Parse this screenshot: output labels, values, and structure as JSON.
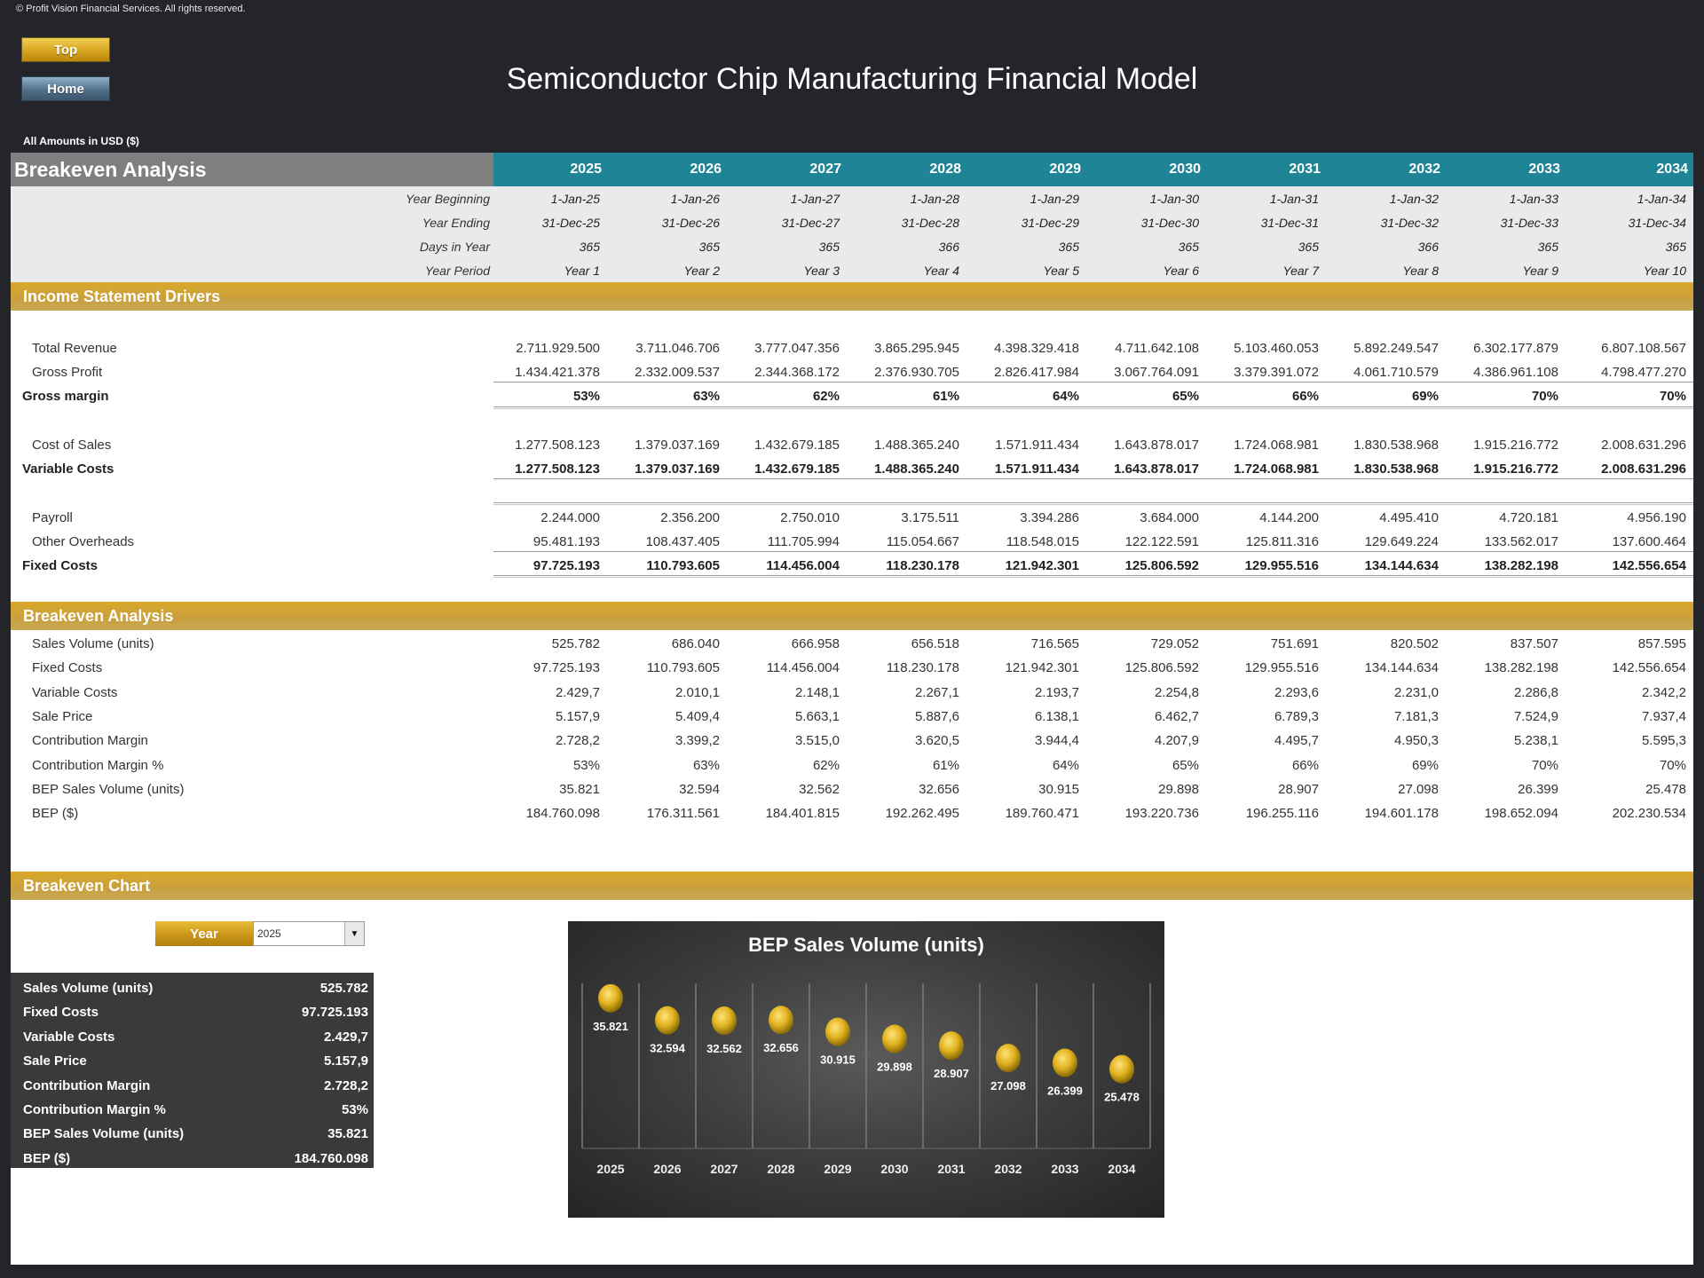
{
  "copyright": "© Profit Vision Financial Services. All rights reserved.",
  "nav": {
    "top_label": "Top",
    "home_label": "Home"
  },
  "page_title": "Semiconductor Chip Manufacturing Financial Model",
  "currency_note": "All Amounts in  USD ($)",
  "colors": {
    "teal": "#1f8596",
    "gold": "#d9a92a",
    "gray_header": "#7f7f7f",
    "dark_bg": "#23252b"
  },
  "header": {
    "title": "Breakeven Analysis",
    "years": [
      "2025",
      "2026",
      "2027",
      "2028",
      "2029",
      "2030",
      "2031",
      "2032",
      "2033",
      "2034"
    ]
  },
  "meta": [
    {
      "label": "Year Beginning",
      "values": [
        "1-Jan-25",
        "1-Jan-26",
        "1-Jan-27",
        "1-Jan-28",
        "1-Jan-29",
        "1-Jan-30",
        "1-Jan-31",
        "1-Jan-32",
        "1-Jan-33",
        "1-Jan-34"
      ]
    },
    {
      "label": "Year Ending",
      "values": [
        "31-Dec-25",
        "31-Dec-26",
        "31-Dec-27",
        "31-Dec-28",
        "31-Dec-29",
        "31-Dec-30",
        "31-Dec-31",
        "31-Dec-32",
        "31-Dec-33",
        "31-Dec-34"
      ]
    },
    {
      "label": "Days in Year",
      "values": [
        "365",
        "365",
        "365",
        "366",
        "365",
        "365",
        "365",
        "366",
        "365",
        "365"
      ]
    },
    {
      "label": "Year Period",
      "values": [
        "Year 1",
        "Year 2",
        "Year 3",
        "Year 4",
        "Year 5",
        "Year 6",
        "Year 7",
        "Year 8",
        "Year 9",
        "Year 10"
      ]
    }
  ],
  "income_section": {
    "title": "Income Statement Drivers",
    "rows": [
      {
        "label": "Total Revenue",
        "bold": false,
        "values": [
          "2.711.929.500",
          "3.711.046.706",
          "3.777.047.356",
          "3.865.295.945",
          "4.398.329.418",
          "4.711.642.108",
          "5.103.460.053",
          "5.892.249.547",
          "6.302.177.879",
          "6.807.108.567"
        ]
      },
      {
        "label": "Gross Profit",
        "bold": false,
        "values": [
          "1.434.421.378",
          "2.332.009.537",
          "2.344.368.172",
          "2.376.930.705",
          "2.826.417.984",
          "3.067.764.091",
          "3.379.391.072",
          "4.061.710.579",
          "4.386.961.108",
          "4.798.477.270"
        ]
      },
      {
        "label": "Gross margin",
        "bold": true,
        "values": [
          "53%",
          "63%",
          "62%",
          "61%",
          "64%",
          "65%",
          "66%",
          "69%",
          "70%",
          "70%"
        ]
      },
      {
        "label": "Cost of Sales",
        "bold": false,
        "values": [
          "1.277.508.123",
          "1.379.037.169",
          "1.432.679.185",
          "1.488.365.240",
          "1.571.911.434",
          "1.643.878.017",
          "1.724.068.981",
          "1.830.538.968",
          "1.915.216.772",
          "2.008.631.296"
        ]
      },
      {
        "label": "Variable Costs",
        "bold": true,
        "values": [
          "1.277.508.123",
          "1.379.037.169",
          "1.432.679.185",
          "1.488.365.240",
          "1.571.911.434",
          "1.643.878.017",
          "1.724.068.981",
          "1.830.538.968",
          "1.915.216.772",
          "2.008.631.296"
        ]
      },
      {
        "label": "Payroll",
        "bold": false,
        "values": [
          "2.244.000",
          "2.356.200",
          "2.750.010",
          "3.175.511",
          "3.394.286",
          "3.684.000",
          "4.144.200",
          "4.495.410",
          "4.720.181",
          "4.956.190"
        ]
      },
      {
        "label": "Other Overheads",
        "bold": false,
        "values": [
          "95.481.193",
          "108.437.405",
          "111.705.994",
          "115.054.667",
          "118.548.015",
          "122.122.591",
          "125.811.316",
          "129.649.224",
          "133.562.017",
          "137.600.464"
        ]
      },
      {
        "label": "Fixed Costs",
        "bold": true,
        "values": [
          "97.725.193",
          "110.793.605",
          "114.456.004",
          "118.230.178",
          "121.942.301",
          "125.806.592",
          "129.955.516",
          "134.144.634",
          "138.282.198",
          "142.556.654"
        ]
      }
    ]
  },
  "breakeven_section": {
    "title": "Breakeven Analysis",
    "rows": [
      {
        "label": "Sales Volume (units)",
        "values": [
          "525.782",
          "686.040",
          "666.958",
          "656.518",
          "716.565",
          "729.052",
          "751.691",
          "820.502",
          "837.507",
          "857.595"
        ]
      },
      {
        "label": "Fixed Costs",
        "values": [
          "97.725.193",
          "110.793.605",
          "114.456.004",
          "118.230.178",
          "121.942.301",
          "125.806.592",
          "129.955.516",
          "134.144.634",
          "138.282.198",
          "142.556.654"
        ]
      },
      {
        "label": "Variable Costs",
        "values": [
          "2.429,7",
          "2.010,1",
          "2.148,1",
          "2.267,1",
          "2.193,7",
          "2.254,8",
          "2.293,6",
          "2.231,0",
          "2.286,8",
          "2.342,2"
        ]
      },
      {
        "label": "Sale Price",
        "values": [
          "5.157,9",
          "5.409,4",
          "5.663,1",
          "5.887,6",
          "6.138,1",
          "6.462,7",
          "6.789,3",
          "7.181,3",
          "7.524,9",
          "7.937,4"
        ]
      },
      {
        "label": "Contribution Margin",
        "values": [
          "2.728,2",
          "3.399,2",
          "3.515,0",
          "3.620,5",
          "3.944,4",
          "4.207,9",
          "4.495,7",
          "4.950,3",
          "5.238,1",
          "5.595,3"
        ]
      },
      {
        "label": "Contribution Margin %",
        "values": [
          "53%",
          "63%",
          "62%",
          "61%",
          "64%",
          "65%",
          "66%",
          "69%",
          "70%",
          "70%"
        ]
      },
      {
        "label": "BEP Sales Volume (units)",
        "values": [
          "35.821",
          "32.594",
          "32.562",
          "32.656",
          "30.915",
          "29.898",
          "28.907",
          "27.098",
          "26.399",
          "25.478"
        ]
      },
      {
        "label": "BEP ($)",
        "values": [
          "184.760.098",
          "176.311.561",
          "184.401.815",
          "192.262.495",
          "189.760.471",
          "193.220.736",
          "196.255.116",
          "194.601.178",
          "198.652.094",
          "202.230.534"
        ]
      }
    ]
  },
  "chart_section": {
    "title": "Breakeven Chart",
    "year_label": "Year",
    "selected_year": "2025",
    "summary": [
      {
        "label": "Sales Volume (units)",
        "value": "525.782"
      },
      {
        "label": "Fixed Costs",
        "value": "97.725.193"
      },
      {
        "label": "Variable Costs",
        "value": "2.429,7"
      },
      {
        "label": "Sale Price",
        "value": "5.157,9"
      },
      {
        "label": "Contribution Margin",
        "value": "2.728,2"
      },
      {
        "label": "Contribution Margin %",
        "value": "53%"
      },
      {
        "label": "BEP Sales Volume (units)",
        "value": "35.821"
      },
      {
        "label": "BEP ($)",
        "value": "184.760.098"
      }
    ]
  },
  "chart_data": {
    "type": "scatter",
    "title": "BEP Sales Volume (units)",
    "categories": [
      "2025",
      "2026",
      "2027",
      "2028",
      "2029",
      "2030",
      "2031",
      "2032",
      "2033",
      "2034"
    ],
    "values": [
      35821,
      32594,
      32562,
      32656,
      30915,
      29898,
      28907,
      27098,
      26399,
      25478
    ],
    "value_labels": [
      "35.821",
      "32.594",
      "32.562",
      "32.656",
      "30.915",
      "29.898",
      "28.907",
      "27.098",
      "26.399",
      "25.478"
    ],
    "xlabel": "",
    "ylabel": "",
    "ylim": [
      0,
      40000
    ],
    "grid": "vertical",
    "legend": "none",
    "marker_color": "#e0b21f"
  }
}
